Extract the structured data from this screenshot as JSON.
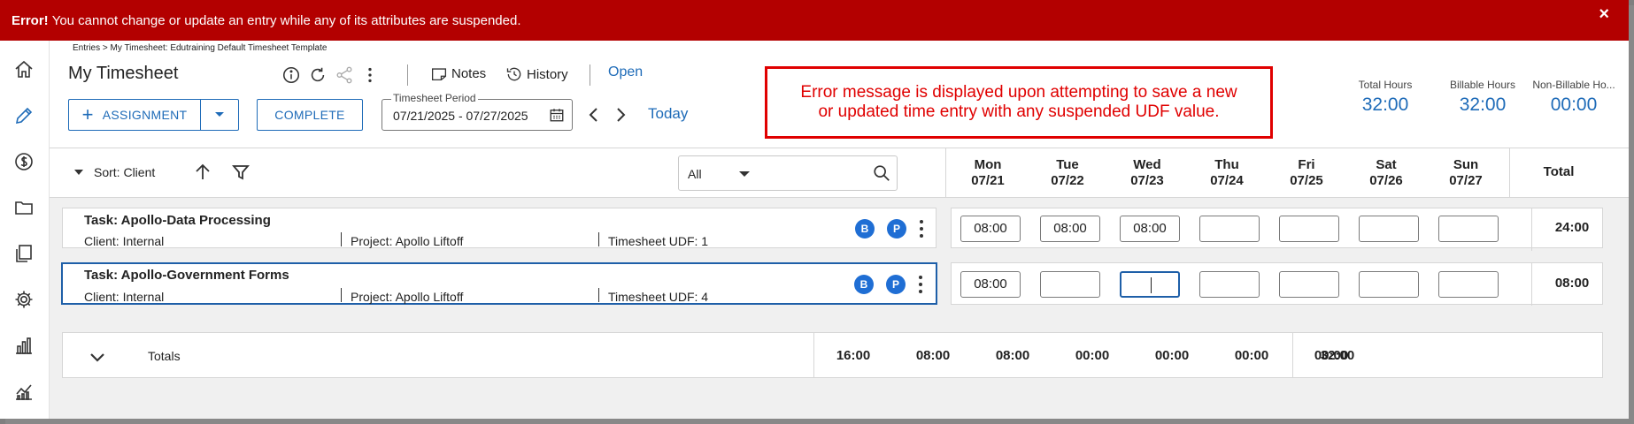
{
  "error": {
    "strong": "Error!",
    "message": "You cannot change or update an entry while any of its attributes are suspended.",
    "close": "×"
  },
  "breadcrumb": "Entries > My Timesheet: Edutraining Default Timesheet Template",
  "title": "My Timesheet",
  "header_links": {
    "notes": "Notes",
    "history": "History",
    "open": "Open"
  },
  "buttons": {
    "assignment": "ASSIGNMENT",
    "complete": "COMPLETE",
    "today": "Today"
  },
  "period": {
    "label": "Timesheet Period",
    "value": "07/21/2025 - 07/27/2025"
  },
  "annotation": {
    "line1": "Error message is displayed upon attempting to save a new",
    "line2": "or updated time entry with any suspended UDF value."
  },
  "stats": [
    {
      "label": "Total Hours",
      "value": "32:00"
    },
    {
      "label": "Billable Hours",
      "value": "32:00"
    },
    {
      "label": "Non-Billable Ho...",
      "value": "00:00"
    }
  ],
  "toolbar": {
    "sort": "Sort: Client",
    "filter_value": "All"
  },
  "days": [
    {
      "name": "Mon",
      "date": "07/21"
    },
    {
      "name": "Tue",
      "date": "07/22"
    },
    {
      "name": "Wed",
      "date": "07/23"
    },
    {
      "name": "Thu",
      "date": "07/24"
    },
    {
      "name": "Fri",
      "date": "07/25"
    },
    {
      "name": "Sat",
      "date": "07/26"
    },
    {
      "name": "Sun",
      "date": "07/27"
    }
  ],
  "total_label": "Total",
  "rows": [
    {
      "task": "Task: Apollo-Data Processing",
      "client": "Client: Internal",
      "project": "Project: Apollo Liftoff",
      "udf": "Timesheet UDF: 1",
      "badge1": "B",
      "badge2": "P",
      "hours": [
        "08:00",
        "08:00",
        "08:00",
        "",
        "",
        "",
        ""
      ],
      "total": "24:00"
    },
    {
      "task": "Task: Apollo-Government Forms",
      "client": "Client: Internal",
      "project": "Project: Apollo Liftoff",
      "udf": "Timesheet UDF: 4",
      "badge1": "B",
      "badge2": "P",
      "hours": [
        "08:00",
        "",
        "",
        "",
        "",
        "",
        ""
      ],
      "total": "08:00"
    }
  ],
  "totals": {
    "label": "Totals",
    "values": [
      "16:00",
      "08:00",
      "08:00",
      "00:00",
      "00:00",
      "00:00",
      "00:00"
    ],
    "total": "32:00"
  }
}
